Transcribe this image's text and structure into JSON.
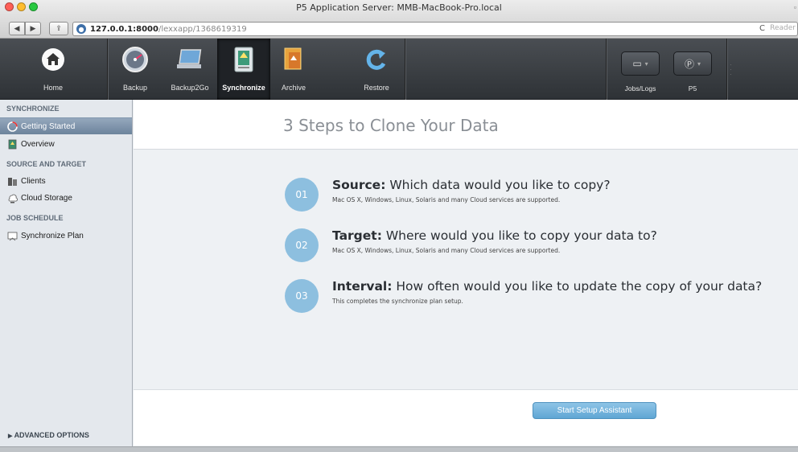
{
  "window": {
    "title": "P5 Application Server: MMB-MacBook-Pro.local",
    "url_host": "127.0.0.1:8000",
    "url_path": "/lexxapp/1368619319",
    "reader_label": "Reader",
    "reload_glyph": "C",
    "back_glyph": "◀",
    "forward_glyph": "▶",
    "share_glyph": "⇪",
    "traffic_colors": [
      "#ff5f57",
      "#ffbd2e",
      "#28c940"
    ]
  },
  "toolbar": {
    "items": [
      {
        "label": "Home",
        "icon": "home-icon",
        "glyph": "⌂"
      },
      {
        "label": "Backup",
        "icon": "backup-gauge-icon",
        "glyph": "◔"
      },
      {
        "label": "Backup2Go",
        "icon": "laptop-icon",
        "glyph": "▭"
      },
      {
        "label": "Synchronize",
        "icon": "sync-icon",
        "glyph": "⇅"
      },
      {
        "label": "Archive",
        "icon": "archive-icon",
        "glyph": "▥"
      },
      {
        "label": "Restore",
        "icon": "restore-icon",
        "glyph": "↻"
      }
    ],
    "active": "Synchronize",
    "right": [
      {
        "label": "Jobs/Logs",
        "icon": "monitor-icon",
        "glyph": "▭"
      },
      {
        "label": "P5",
        "icon": "p5-icon",
        "glyph": "Ⓟ"
      }
    ]
  },
  "sidebar": {
    "sections": [
      {
        "title": "SYNCHRONIZE",
        "items": [
          {
            "label": "Getting Started",
            "icon": "getting-started-icon",
            "selected": true
          },
          {
            "label": "Overview",
            "icon": "overview-icon",
            "selected": false
          }
        ]
      },
      {
        "title": "SOURCE AND TARGET",
        "items": [
          {
            "label": "Clients",
            "icon": "clients-icon",
            "selected": false
          },
          {
            "label": "Cloud Storage",
            "icon": "cloud-storage-icon",
            "selected": false
          }
        ]
      },
      {
        "title": "JOB SCHEDULE",
        "items": [
          {
            "label": "Synchronize Plan",
            "icon": "synchronize-plan-icon",
            "selected": false
          }
        ]
      }
    ],
    "advanced": "ADVANCED OPTIONS",
    "advanced_glyph": "▶"
  },
  "main": {
    "heading": "3 Steps to Clone Your Data",
    "steps": [
      {
        "number": "01",
        "title_bold": "Source:",
        "title_rest": " Which data would you like to copy?",
        "subtitle": "Mac OS X, Windows, Linux, Solaris and many Cloud services are supported."
      },
      {
        "number": "02",
        "title_bold": "Target:",
        "title_rest": " Where would you like to copy your data to?",
        "subtitle": "Mac OS X, Windows, Linux, Solaris and many Cloud services are supported."
      },
      {
        "number": "03",
        "title_bold": "Interval:",
        "title_rest": " How often would you like to update the copy of your data?",
        "subtitle": "This completes the synchronize plan setup."
      }
    ],
    "start_button": "Start Setup Assistant"
  },
  "colors": {
    "accent": "#8dbfdf",
    "button": "#6fb3dd",
    "selection": "#7a8fa6",
    "toolbar": "#3a3e43"
  }
}
